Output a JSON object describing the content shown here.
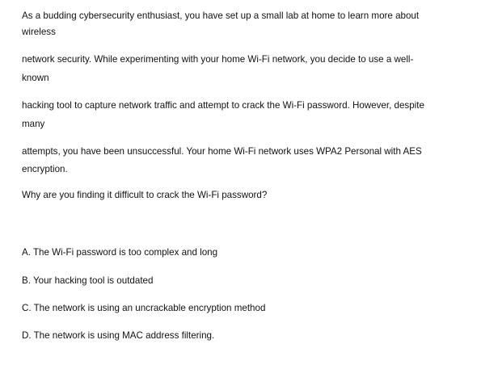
{
  "question": {
    "lines": [
      "As a budding cybersecurity enthusiast, you have set up a small lab at home to learn more about",
      "wireless",
      "network security. While experimenting with your home Wi-Fi network, you decide to use a well-",
      "known",
      "hacking tool to capture network traffic and attempt to crack the Wi-Fi password. However, despite",
      "many",
      "attempts, you have been unsuccessful. Your home Wi-Fi network uses WPA2 Personal with AES",
      "encryption."
    ],
    "prompt": "Why are you finding it difficult to crack the Wi-Fi password?"
  },
  "options": [
    "A. The Wi-Fi password is too complex and long",
    "B. Your hacking tool is outdated",
    "C. The network is using an uncrackable encryption method",
    "D. The network is using MAC address filtering."
  ]
}
